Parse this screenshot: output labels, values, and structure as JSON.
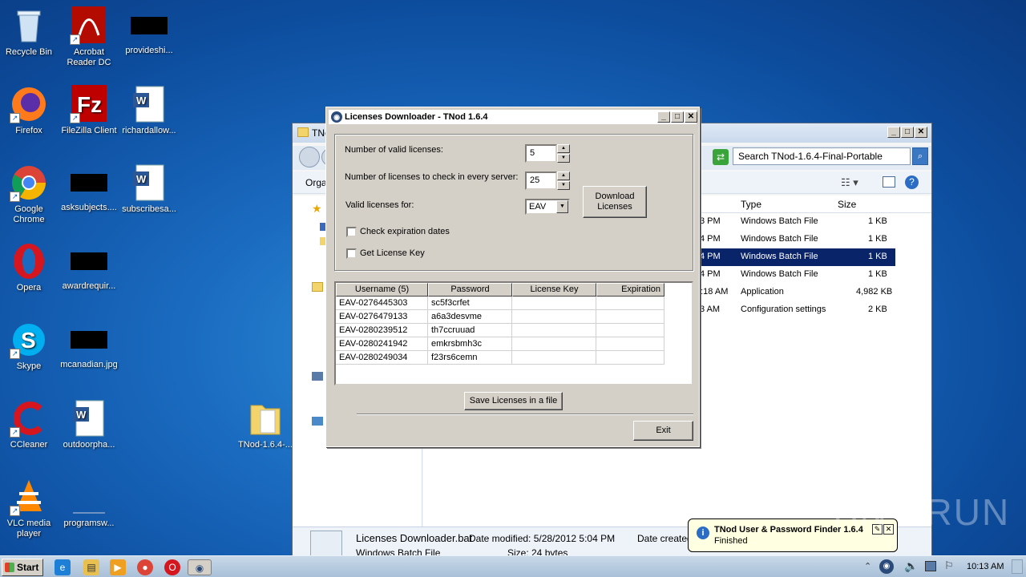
{
  "desktop": {
    "icons": [
      {
        "label": "Recycle Bin",
        "icon": "recycle-bin-icon"
      },
      {
        "label": "Acrobat Reader DC",
        "icon": "acrobat-icon"
      },
      {
        "label": "provideshi...",
        "icon": "redacted-icon"
      },
      {
        "label": "Firefox",
        "icon": "firefox-icon"
      },
      {
        "label": "FileZilla Client",
        "icon": "filezilla-icon"
      },
      {
        "label": "richardallow...",
        "icon": "word-doc-icon"
      },
      {
        "label": "Google Chrome",
        "icon": "chrome-icon"
      },
      {
        "label": "asksubjects....",
        "icon": "redacted-icon"
      },
      {
        "label": "subscribesa...",
        "icon": "word-doc-icon"
      },
      {
        "label": "Opera",
        "icon": "opera-icon"
      },
      {
        "label": "awardrequir...",
        "icon": "redacted-icon"
      },
      {
        "label": "Skype",
        "icon": "skype-icon"
      },
      {
        "label": "mcanadian.jpg",
        "icon": "redacted-icon"
      },
      {
        "label": "CCleaner",
        "icon": "ccleaner-icon"
      },
      {
        "label": "outdoorpha...",
        "icon": "word-doc-icon"
      },
      {
        "label": "TNod-1.6.4-...",
        "icon": "folder-icon"
      },
      {
        "label": "VLC media player",
        "icon": "vlc-icon"
      },
      {
        "label": "programsw...",
        "icon": "blank-file-icon"
      }
    ]
  },
  "explorer": {
    "title": "TNod",
    "search_placeholder": "Search TNod-1.6.4-Final-Portable",
    "organize_label": "Organ",
    "columns": {
      "type": "Type",
      "size": "Size"
    },
    "rows": [
      {
        "time": "3 PM",
        "type": "Windows Batch File",
        "size": "1 KB",
        "selected": false
      },
      {
        "time": "4 PM",
        "type": "Windows Batch File",
        "size": "1 KB",
        "selected": false
      },
      {
        "time": "4 PM",
        "type": "Windows Batch File",
        "size": "1 KB",
        "selected": true
      },
      {
        "time": "4 PM",
        "type": "Windows Batch File",
        "size": "1 KB",
        "selected": false
      },
      {
        "time": "2:18 AM",
        "type": "Application",
        "size": "4,982 KB",
        "selected": false
      },
      {
        "time": "3 AM",
        "type": "Configuration settings",
        "size": "2 KB",
        "selected": false
      }
    ],
    "details": {
      "filename": "Licenses Downloader.bat",
      "modified": "Date modified: 5/28/2012 5:04 PM",
      "created": "Date created",
      "type": "Windows Batch File",
      "size": "Size: 24 bytes"
    }
  },
  "dialog": {
    "title": "Licenses Downloader - TNod 1.6.4",
    "num_valid_label": "Number of valid licenses:",
    "num_valid_value": "5",
    "num_check_label": "Number of licenses to check in every server:",
    "num_check_value": "25",
    "valid_for_label": "Valid licenses for:",
    "valid_for_value": "EAV",
    "download_label": "Download Licenses",
    "check_expiration_label": "Check expiration dates",
    "get_key_label": "Get License Key",
    "table": {
      "headers": [
        "Username (5)",
        "Password",
        "License Key",
        "Expiration"
      ],
      "rows": [
        [
          "EAV-0276445303",
          "sc5f3crfet",
          "",
          ""
        ],
        [
          "EAV-0276479133",
          "a6a3desvme",
          "",
          ""
        ],
        [
          "EAV-0280239512",
          "th7ccruuad",
          "",
          ""
        ],
        [
          "EAV-0280241942",
          "emkrsbmh3c",
          "",
          ""
        ],
        [
          "EAV-0280249034",
          "f23rs6cemn",
          "",
          ""
        ]
      ]
    },
    "save_label": "Save Licenses in a file",
    "exit_label": "Exit"
  },
  "balloon": {
    "title": "TNod User & Password Finder 1.6.4",
    "text": "Finished"
  },
  "taskbar": {
    "start_label": "Start",
    "clock": "10:13 AM"
  },
  "watermark": "ANY RUN"
}
